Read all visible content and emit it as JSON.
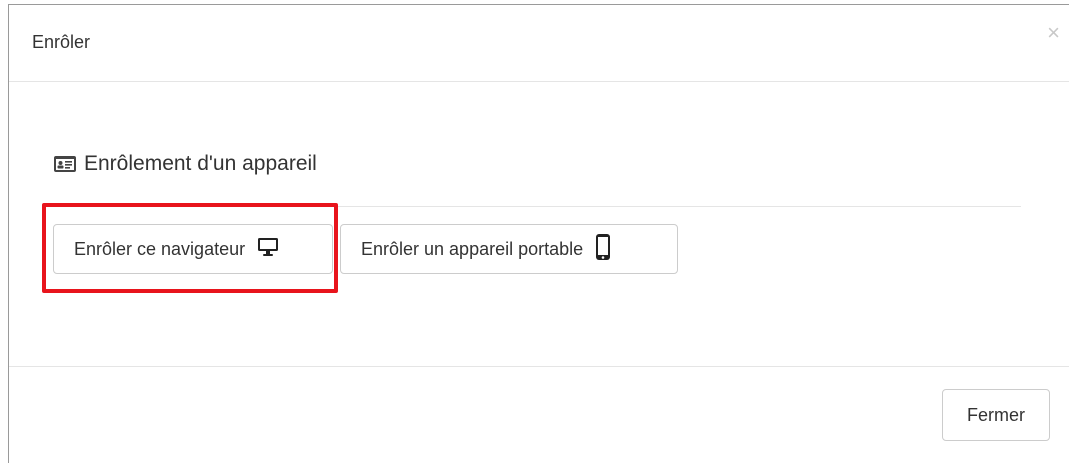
{
  "modal": {
    "title": "Enrôler",
    "close_symbol": "×"
  },
  "section": {
    "heading": "Enrôlement d'un appareil",
    "heading_icon": "id-card-icon"
  },
  "buttons": {
    "enroll_browser": {
      "label": "Enrôler ce navigateur",
      "icon": "desktop-icon"
    },
    "enroll_mobile": {
      "label": "Enrôler un appareil portable",
      "icon": "mobile-phone-icon"
    }
  },
  "footer": {
    "close_label": "Fermer"
  },
  "colors": {
    "highlight": "#e8141c",
    "border": "#cccccc",
    "text": "#333333"
  }
}
